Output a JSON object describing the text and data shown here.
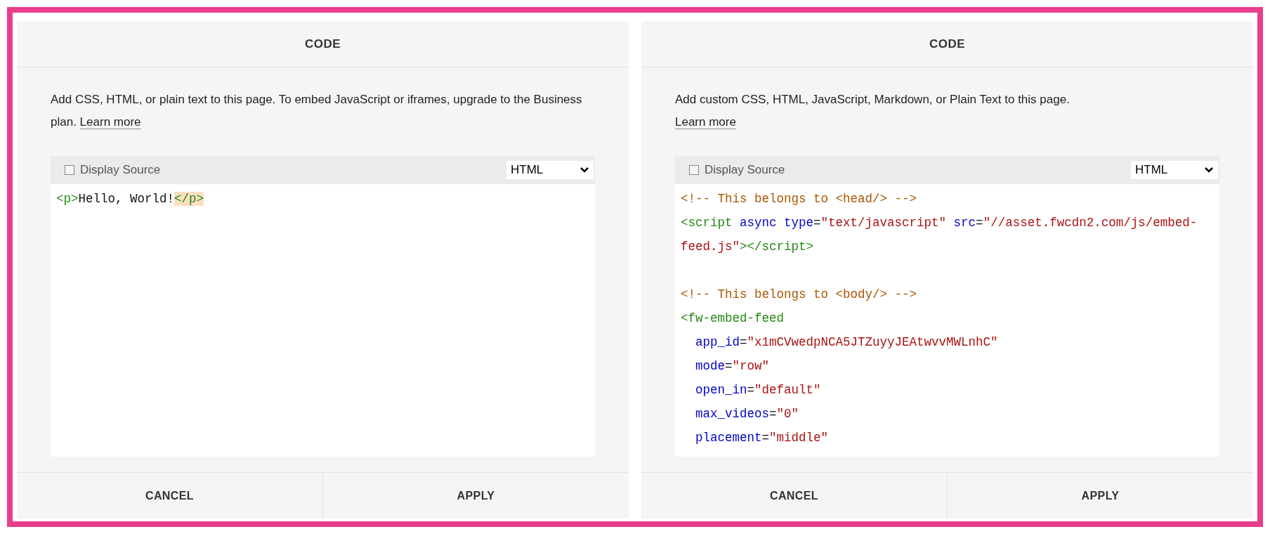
{
  "panels": [
    {
      "title": "CODE",
      "description": "Add CSS, HTML, or plain text to this page. To embed JavaScript or iframes, upgrade to the Business plan.",
      "learn_more": "Learn more",
      "learn_more_own_line": false,
      "display_source": {
        "label": "Display Source",
        "checked": false
      },
      "language": "HTML",
      "code": [
        {
          "kind": "code",
          "tokens": [
            {
              "kind": "tag",
              "text": "<p>"
            },
            {
              "kind": "text",
              "text": "Hello, World!"
            },
            {
              "kind": "tag",
              "text": "</p>",
              "highlighted": true
            }
          ]
        }
      ],
      "buttons": [
        "CANCEL",
        "APPLY"
      ]
    },
    {
      "title": "CODE",
      "description": "Add custom CSS, HTML, JavaScript, Markdown, or Plain Text to this page.",
      "learn_more": "Learn more",
      "learn_more_own_line": true,
      "display_source": {
        "label": "Display Source",
        "checked": false
      },
      "language": "HTML",
      "code": [
        {
          "kind": "code",
          "tokens": [
            {
              "kind": "comment",
              "text": "<!-- This belongs to <head/> -->"
            }
          ]
        },
        {
          "kind": "code",
          "tokens": [
            {
              "kind": "tag",
              "text": "<script"
            },
            {
              "kind": "attr",
              "text": " async type"
            },
            {
              "kind": "text",
              "text": "="
            },
            {
              "kind": "string",
              "text": "\"text/javascript\""
            },
            {
              "kind": "attr",
              "text": " src"
            },
            {
              "kind": "text",
              "text": "="
            },
            {
              "kind": "string",
              "text": "\"//asset.fwcdn2.com/js/embed-feed.js\""
            },
            {
              "kind": "tag",
              "text": "></script>"
            }
          ]
        },
        {
          "kind": "blank"
        },
        {
          "kind": "code",
          "tokens": [
            {
              "kind": "comment",
              "text": "<!-- This belongs to <body/> -->"
            }
          ]
        },
        {
          "kind": "code",
          "tokens": [
            {
              "kind": "tag",
              "text": "<fw-embed-feed"
            }
          ]
        },
        {
          "kind": "code",
          "tokens": [
            {
              "kind": "attr",
              "text": "  app_id"
            },
            {
              "kind": "text",
              "text": "="
            },
            {
              "kind": "string",
              "text": "\"x1mCVwedpNCA5JTZuyyJEAtwvvMWLnhC\""
            }
          ]
        },
        {
          "kind": "code",
          "tokens": [
            {
              "kind": "attr",
              "text": "  mode"
            },
            {
              "kind": "text",
              "text": "="
            },
            {
              "kind": "string",
              "text": "\"row\""
            }
          ]
        },
        {
          "kind": "code",
          "tokens": [
            {
              "kind": "attr",
              "text": "  open_in"
            },
            {
              "kind": "text",
              "text": "="
            },
            {
              "kind": "string",
              "text": "\"default\""
            }
          ]
        },
        {
          "kind": "code",
          "tokens": [
            {
              "kind": "attr",
              "text": "  max_videos"
            },
            {
              "kind": "text",
              "text": "="
            },
            {
              "kind": "string",
              "text": "\"0\""
            }
          ]
        },
        {
          "kind": "code",
          "tokens": [
            {
              "kind": "attr",
              "text": "  placement"
            },
            {
              "kind": "text",
              "text": "="
            },
            {
              "kind": "string",
              "text": "\"middle\""
            }
          ]
        }
      ],
      "buttons": [
        "CANCEL",
        "APPLY"
      ]
    }
  ]
}
